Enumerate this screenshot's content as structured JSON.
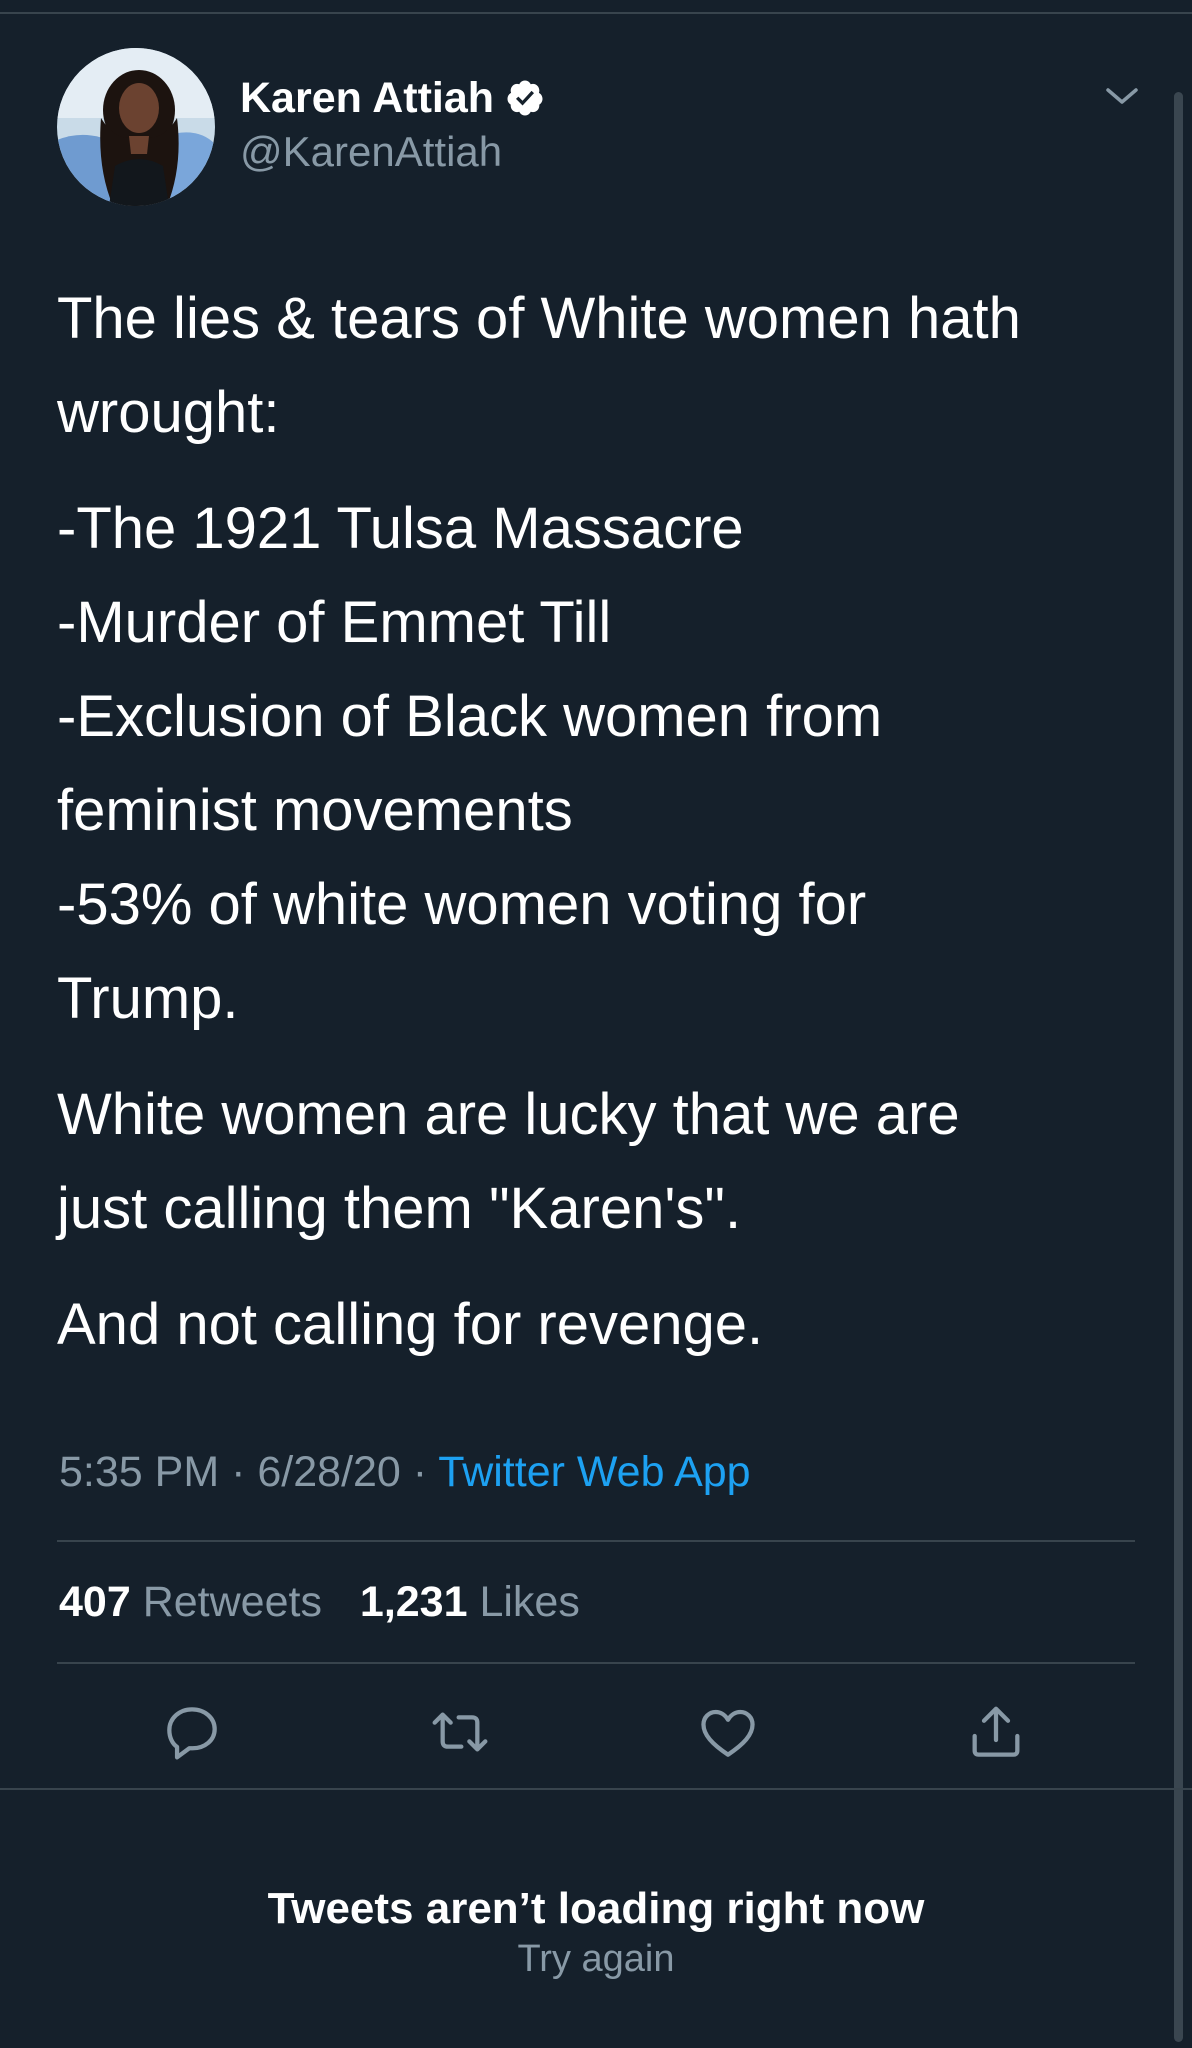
{
  "author": {
    "display_name": "Karen Attiah",
    "handle": "@KarenAttiah",
    "verified": true,
    "avatar_icon": "profile-photo"
  },
  "tweet": {
    "lines": [
      "The lies & tears of White women hath",
      "wrought:",
      "-The 1921 Tulsa Massacre",
      "-Murder of Emmet Till",
      "-Exclusion of Black women from",
      "feminist movements",
      "-53% of white women voting for",
      "Trump.",
      "White women are lucky that we are",
      "just calling them \"Karen's\".",
      "And not calling for revenge."
    ],
    "time": "5:35 PM",
    "date": "6/28/20",
    "separator": "·",
    "source": "Twitter Web App"
  },
  "stats": {
    "retweets_count": "407",
    "retweets_label": "Retweets",
    "likes_count": "1,231",
    "likes_label": "Likes"
  },
  "actions": [
    "reply-icon",
    "retweet-icon",
    "like-icon",
    "share-icon"
  ],
  "error": {
    "title": "Tweets aren’t loading right now",
    "retry": "Try again"
  },
  "colors": {
    "background": "#15202b",
    "text": "#ffffff",
    "secondary": "#8899a6",
    "accent": "#1da1f2",
    "divider": "#38444d"
  }
}
